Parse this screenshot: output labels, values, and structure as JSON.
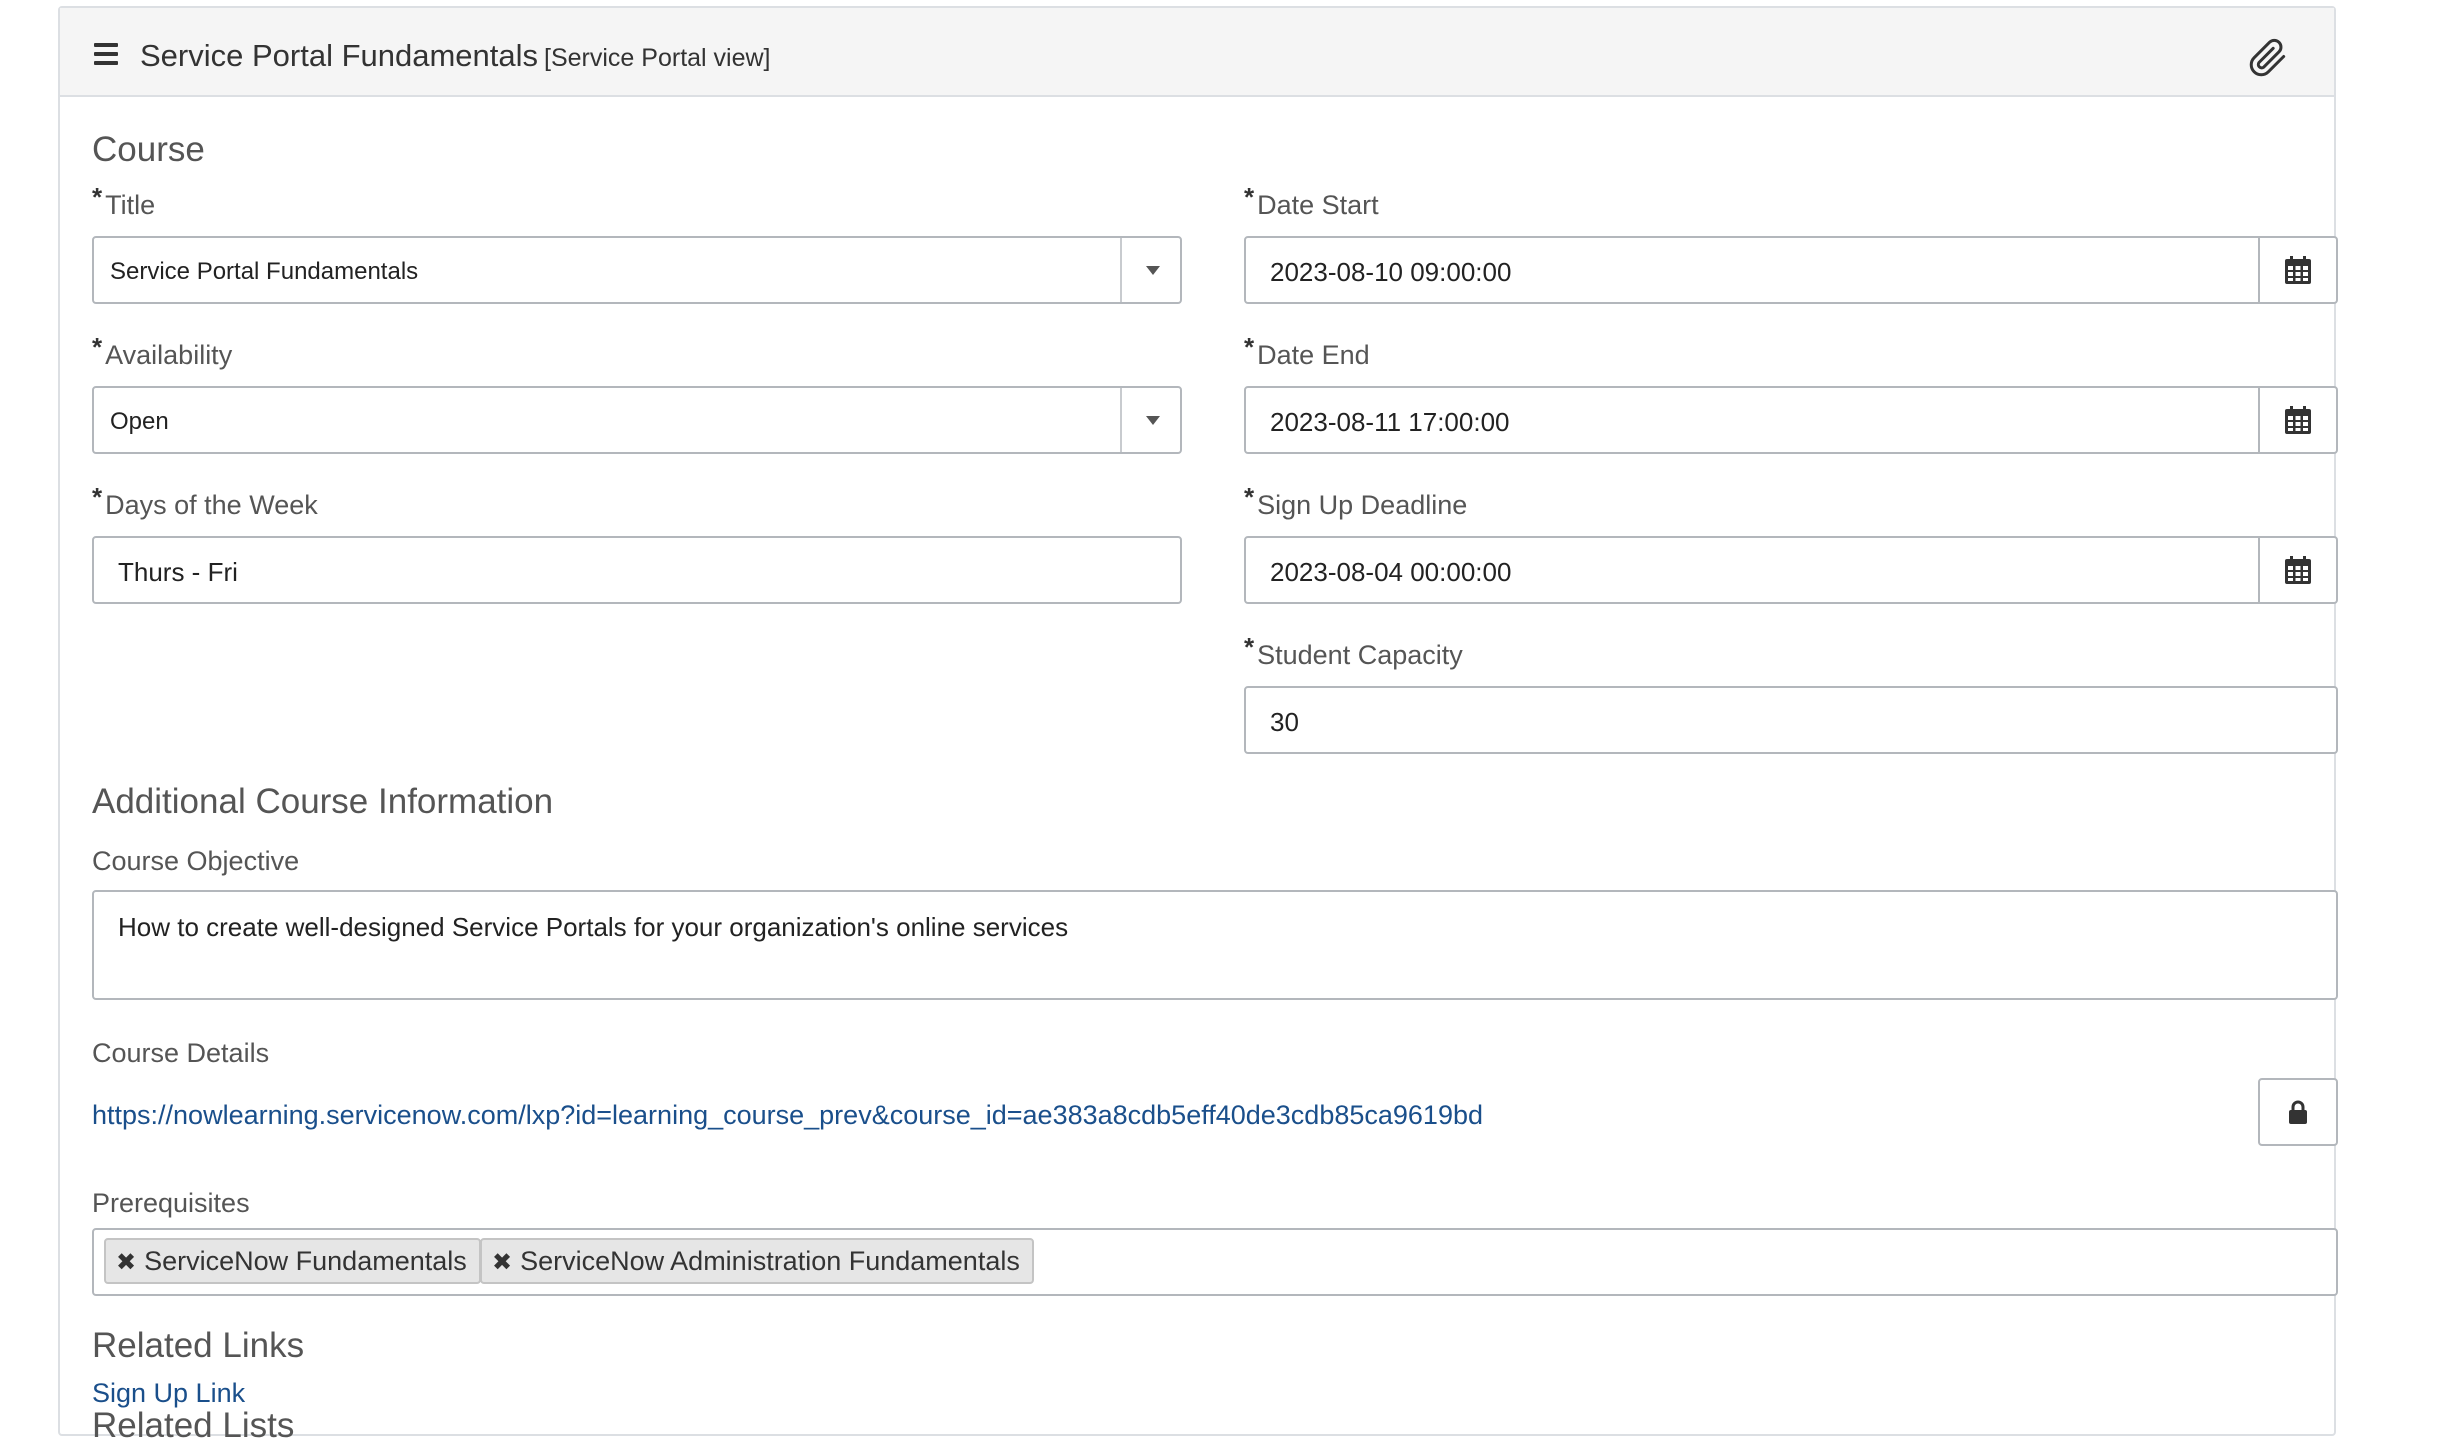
{
  "header": {
    "title": "Service Portal Fundamentals",
    "view": "[Service Portal view]",
    "menu_icon": "hamburger-menu-icon",
    "attach_icon": "paperclip-icon"
  },
  "course": {
    "section_title": "Course",
    "required_marker": "*",
    "title": {
      "label": "Title",
      "value": "Service Portal Fundamentals"
    },
    "availability": {
      "label": "Availability",
      "value": "Open"
    },
    "days": {
      "label": "Days of the Week",
      "value": "Thurs - Fri"
    },
    "date_start": {
      "label": "Date Start",
      "value": "2023-08-10 09:00:00"
    },
    "date_end": {
      "label": "Date End",
      "value": "2023-08-11 17:00:00"
    },
    "signup_deadline": {
      "label": "Sign Up Deadline",
      "value": "2023-08-04 00:00:00"
    },
    "capacity": {
      "label": "Student Capacity",
      "value": "30"
    }
  },
  "additional": {
    "section_title": "Additional Course Information",
    "objective": {
      "label": "Course Objective",
      "value": "How to create well-designed Service Portals for your organization's online services"
    },
    "details": {
      "label": "Course Details",
      "value": "https://nowlearning.servicenow.com/lxp?id=learning_course_prev&course_id=ae383a8cdb5eff40de3cdb85ca9619bd"
    },
    "prerequisites": {
      "label": "Prerequisites",
      "tags": [
        "ServiceNow Fundamentals",
        "ServiceNow Administration Fundamentals"
      ],
      "remove_glyph": "✖"
    }
  },
  "related_links": {
    "section_title": "Related Links",
    "items": [
      "Sign Up Link"
    ]
  },
  "related_lists": {
    "section_title": "Related Lists"
  },
  "colors": {
    "link": "#1a4f8b",
    "header_bg": "#f5f5f5",
    "border": "#b3b7bc"
  }
}
